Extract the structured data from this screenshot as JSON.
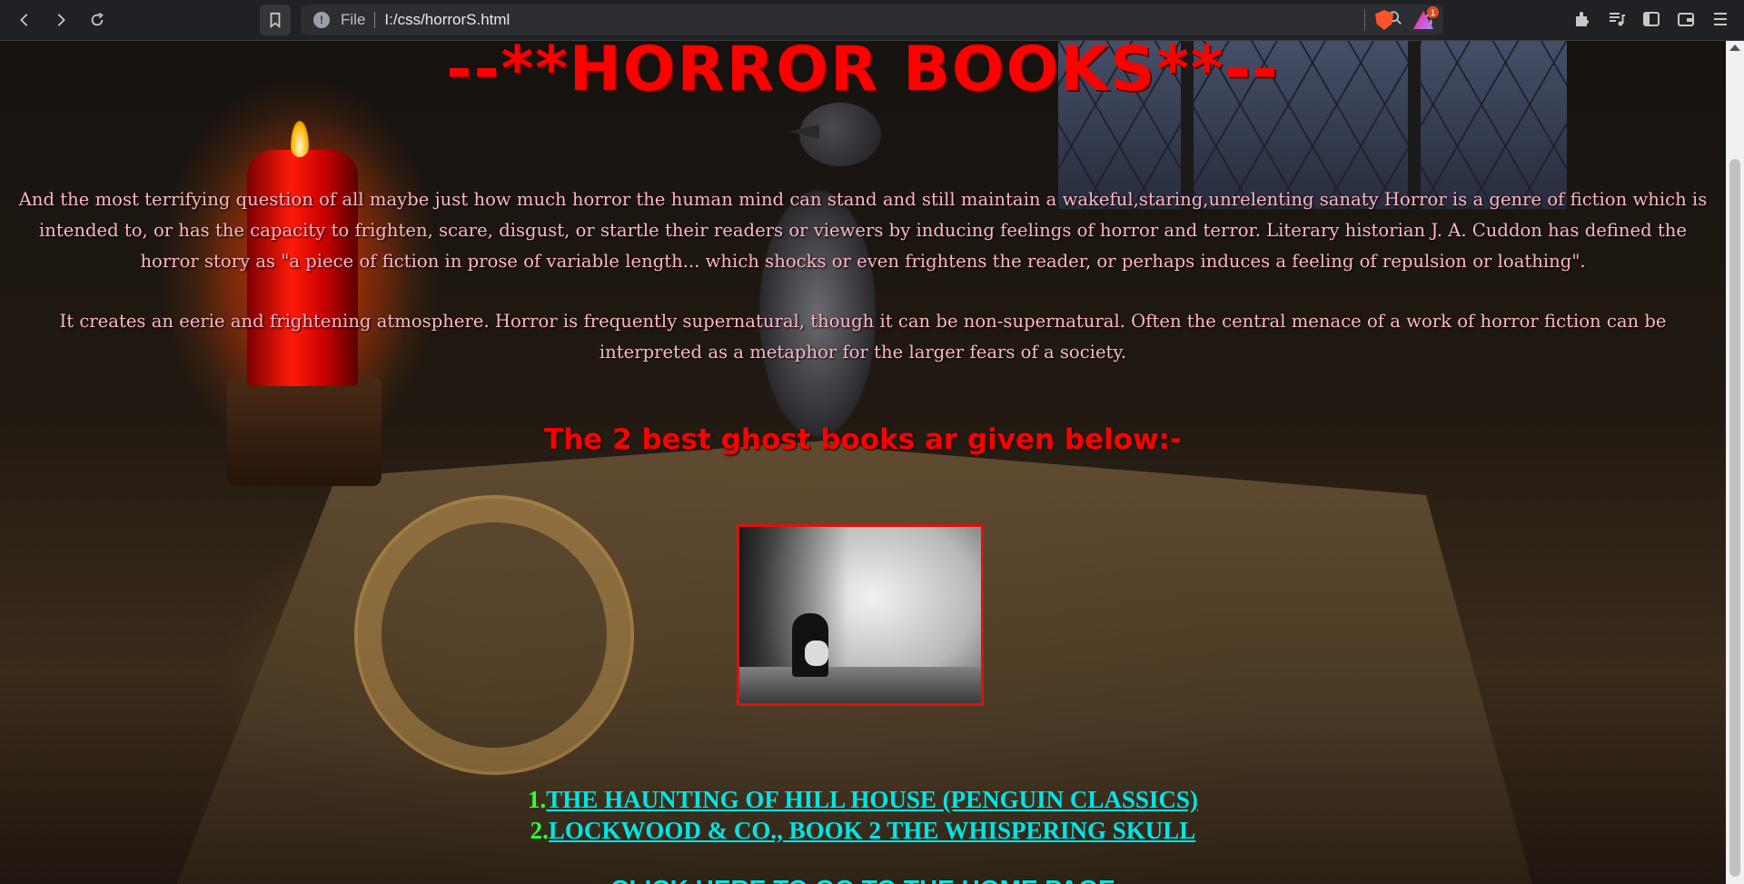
{
  "browser": {
    "scheme": "File",
    "url": "I:/css/horrorS.html",
    "icons": [
      "back-icon",
      "forward-icon",
      "reload-icon",
      "bookmark-icon",
      "info-icon",
      "zoom-icon",
      "share-icon",
      "brave-shield-icon",
      "brave-rewards-icon",
      "extensions-icon",
      "media-icon",
      "sidebar-icon",
      "wallet-icon",
      "menu-icon"
    ],
    "rewards_badge": "1"
  },
  "page": {
    "title": "--**HORROR BOOKS**--",
    "paragraph1": "And the most terrifying question of all maybe just how much horror the human mind can stand and still maintain a wakeful,staring,unrelenting sanaty Horror is a genre of fiction which is intended to, or has the capacity to frighten, scare, disgust, or startle their readers or viewers by inducing feelings of horror and terror. Literary historian J. A. Cuddon has defined the horror story as \"a piece of fiction in prose of variable length... which shocks or even frightens the reader, or perhaps induces a feeling of repulsion or loathing\".",
    "paragraph2": "It creates an eerie and frightening atmosphere. Horror is frequently supernatural, though it can be non-supernatural. Often the central menace of a work of horror fiction can be interpreted as a metaphor for the larger fears of a society.",
    "subtitle": "The 2 best ghost books ar given below:-",
    "books": [
      {
        "num": "1.",
        "title": "THE HAUNTING OF HILL HOUSE (PENGUIN CLASSICS)"
      },
      {
        "num": "2.",
        "title": "LOCKWOOD & CO., BOOK 2 THE WHISPERING SKULL"
      }
    ],
    "home_dots_left": "......................................",
    "home_link": "CLICK HERE TO GO TO THE HOME PAGE",
    "home_dots_right": "......................................"
  },
  "colors": {
    "title": "#ff0000",
    "paragraph": "#ffb6c1",
    "link": "#00e5e5",
    "number": "#33ff33",
    "dots": "#ff69b4",
    "cover_border": "#e01010"
  }
}
